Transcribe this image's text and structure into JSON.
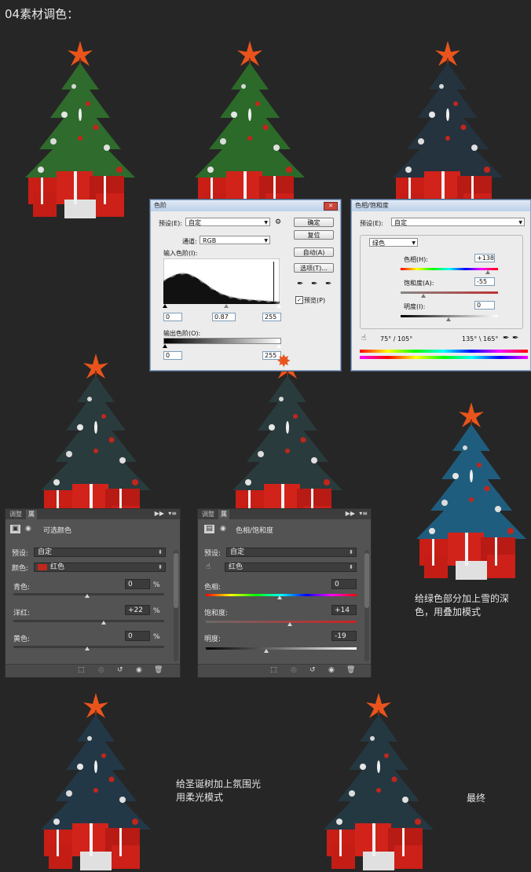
{
  "title": "04素材调色：",
  "levels_dialog": {
    "title": "色阶",
    "close_label": "✕",
    "preset_label": "预设(E):",
    "preset_value": "自定",
    "channel_label": "通道:",
    "channel_value": "RGB",
    "input_levels_label": "输入色阶(I):",
    "input_values": [
      "0",
      "0.87",
      "255"
    ],
    "output_levels_label": "输出色阶(O):",
    "output_values": [
      "0",
      "255"
    ],
    "buttons": {
      "ok": "确定",
      "reset": "复位",
      "auto": "自动(A)",
      "options": "选项(T)..."
    },
    "preview_label": "预览(P)",
    "preview_checked": true
  },
  "hue_sat_dialog": {
    "title": "色相/饱和度",
    "preset_label": "预设(E):",
    "preset_value": "自定",
    "range_value": "绿色",
    "hue_label": "色相(H):",
    "hue_value": "+138",
    "saturation_label": "饱和度(A):",
    "saturation_value": "-55",
    "lightness_label": "明度(I):",
    "lightness_value": "0",
    "range_left": "75° / 105°",
    "range_right": "135° \\ 165°"
  },
  "selective_color_panel": {
    "tab_adjust": "调整",
    "tab_props": "属",
    "header": "可选颜色",
    "preset_label": "预设:",
    "preset_value": "自定",
    "colors_label": "颜色:",
    "colors_value": "红色",
    "colors_swatch": "#c0281c",
    "rows": [
      {
        "label": "青色:",
        "value": "0",
        "unit": "%"
      },
      {
        "label": "洋红:",
        "value": "+22",
        "unit": "%"
      },
      {
        "label": "黄色:",
        "value": "0",
        "unit": "%"
      }
    ]
  },
  "hue_sat_panel": {
    "tab_adjust": "调整",
    "tab_props": "属",
    "header": "色相/饱和度",
    "preset_label": "预设:",
    "preset_value": "自定",
    "channel_value": "红色",
    "rows": [
      {
        "label": "色相:",
        "value": "0"
      },
      {
        "label": "饱和度:",
        "value": "+14"
      },
      {
        "label": "明度:",
        "value": "-19"
      }
    ]
  },
  "notes": {
    "snow_overlay": [
      "给绿色部分加上雪的深",
      "色，用叠加模式"
    ],
    "glow_softlight": [
      "给圣诞树加上氛围光",
      "用柔光模式"
    ],
    "final": "最终"
  },
  "colors": {
    "background": "#262626",
    "gift_red": "#c81e16",
    "star_orange": "#e8541c"
  }
}
